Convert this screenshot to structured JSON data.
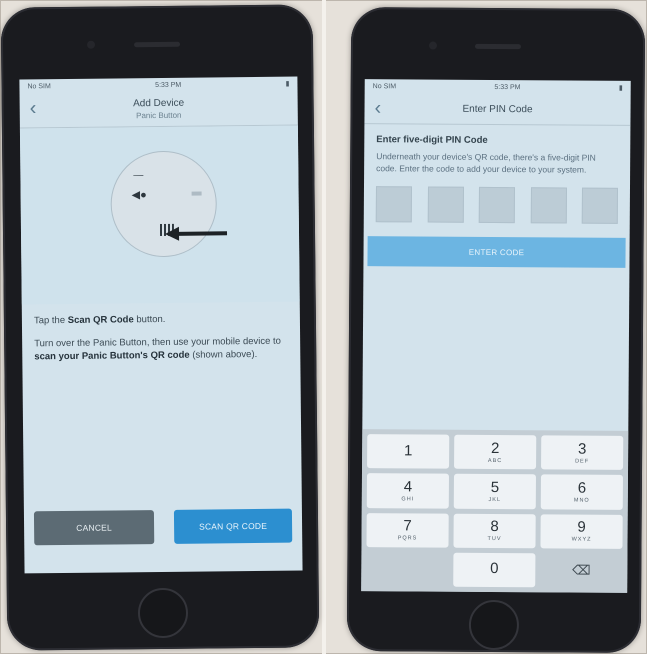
{
  "left_phone": {
    "status": {
      "carrier": "No SIM",
      "time": "5:33 PM",
      "battery": "▮"
    },
    "nav": {
      "back": "‹",
      "title": "Add Device",
      "subtitle": "Panic Button"
    },
    "instructions": {
      "step1_pre": "Tap the ",
      "step1_bold": "Scan QR Code",
      "step1_post": " button.",
      "step2_pre": "Turn over the Panic Button, then use your mobile device to ",
      "step2_bold": "scan your Panic Button's QR code",
      "step2_post": " (shown above)."
    },
    "buttons": {
      "cancel": "CANCEL",
      "scan": "SCAN QR CODE"
    }
  },
  "right_phone": {
    "status": {
      "carrier": "No SIM",
      "time": "5:33 PM",
      "battery": "▮"
    },
    "nav": {
      "back": "‹",
      "title": "Enter PIN Code"
    },
    "pin": {
      "heading": "Enter five-digit PIN Code",
      "description": "Underneath your device's QR code, there's a five-digit PIN code. Enter the code to add your device to your system."
    },
    "enter_button": "ENTER CODE",
    "keypad": [
      {
        "digit": "1",
        "letters": ""
      },
      {
        "digit": "2",
        "letters": "ABC"
      },
      {
        "digit": "3",
        "letters": "DEF"
      },
      {
        "digit": "4",
        "letters": "GHI"
      },
      {
        "digit": "5",
        "letters": "JKL"
      },
      {
        "digit": "6",
        "letters": "MNO"
      },
      {
        "digit": "7",
        "letters": "PQRS"
      },
      {
        "digit": "8",
        "letters": "TUV"
      },
      {
        "digit": "9",
        "letters": "WXYZ"
      },
      {
        "digit": "0",
        "letters": ""
      }
    ],
    "delete_key": "⌫"
  },
  "colors": {
    "primary_button": "#2c8fd0",
    "cancel_button": "#5c6b74",
    "enter_button_disabled": "#6cb5e2"
  }
}
